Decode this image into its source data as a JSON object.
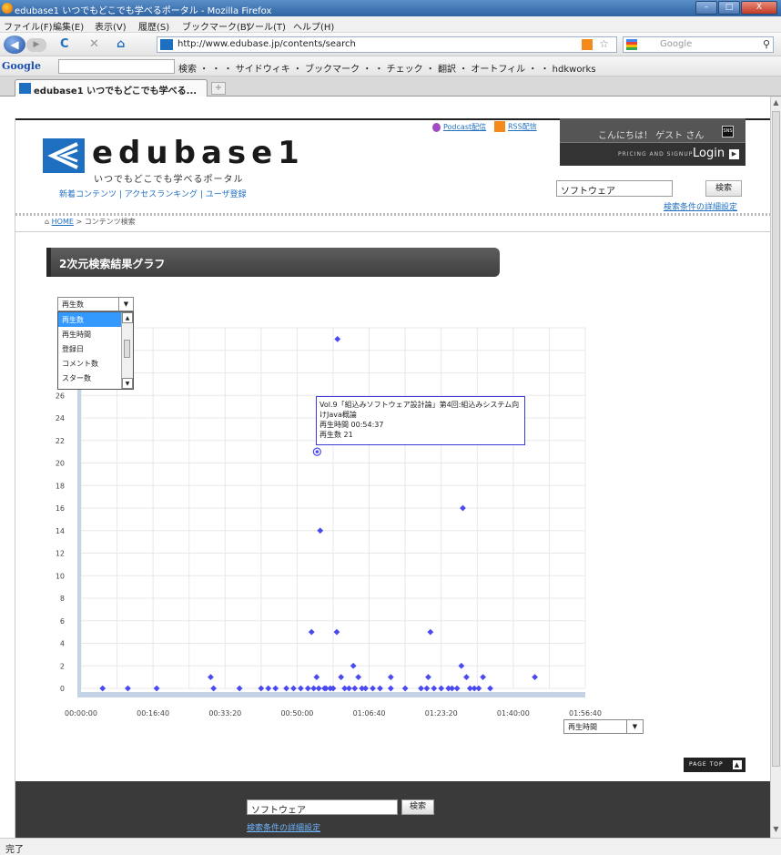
{
  "window": {
    "title": "edubase1 いつでもどこでも学べるポータル - Mozilla Firefox",
    "min": "–",
    "max": "□",
    "close": "X"
  },
  "menu": [
    "ファイル(F)",
    "編集(E)",
    "表示(V)",
    "履歴(S)",
    "ブックマーク(B)",
    "ツール(T)",
    "ヘルプ(H)"
  ],
  "nav": {
    "url": "http://www.edubase.jp/contents/search",
    "search_placeholder": "Google"
  },
  "google_toolbar": {
    "logo": "Google",
    "items": "検索 ・ ・ ・ サイドウィキ ・ ブックマーク ・ ・ チェック ・ 翻訳 ・ オートフィル ・   ・ hdkworks"
  },
  "tab": {
    "label": "edubase1 いつでもどこでも学べる...",
    "new_tab": "+"
  },
  "header": {
    "logo_name": "edubase1",
    "tagline": "いつでもどこでも学べるポータル",
    "links": "新着コンテンツ | アクセスランキング | ユーザ登録",
    "podcast": "Podcast配信",
    "rss": "RSS配信",
    "greeting": "こんにちは！ ゲスト さん",
    "sns": "SNS",
    "pricing": "PRICING AND SIGNUP",
    "login": "Login",
    "search_value": "ソフトウェア",
    "search_button": "検索",
    "advanced": "検索条件の詳細設定"
  },
  "breadcrumb": {
    "home": "HOME",
    "current": "> コンテンツ検索"
  },
  "section_title": "2次元検索結果グラフ",
  "y_select": {
    "value": "再生数",
    "options": [
      "再生数",
      "再生時間",
      "登録日",
      "コメント数",
      "スター数"
    ],
    "selected_index": 0
  },
  "x_select": {
    "value": "再生時間"
  },
  "tooltip": {
    "line1": "Vol.9「組込みソフトウェア設計論」第4回:組込みシステム向",
    "line2": "けJava概論",
    "line3": "再生時間 00:54:37",
    "line4": "再生数 21"
  },
  "chart_data": {
    "type": "scatter",
    "xlabel": "",
    "ylabel": "",
    "x_ticks": [
      "00:00:00",
      "00:16:40",
      "00:33:20",
      "00:50:00",
      "01:06:40",
      "01:23:20",
      "01:40:00",
      "01:56:40"
    ],
    "y_ticks": [
      0,
      2,
      4,
      6,
      8,
      10,
      12,
      14,
      16,
      18,
      20,
      22,
      24,
      26
    ],
    "xlim_seconds": [
      0,
      7000
    ],
    "ylim": [
      0,
      32
    ],
    "color": "#4a4af0",
    "points": [
      {
        "x": 300,
        "y": 0
      },
      {
        "x": 650,
        "y": 0
      },
      {
        "x": 1050,
        "y": 0
      },
      {
        "x": 1840,
        "y": 0
      },
      {
        "x": 1800,
        "y": 1
      },
      {
        "x": 2200,
        "y": 0
      },
      {
        "x": 2500,
        "y": 0
      },
      {
        "x": 2600,
        "y": 0
      },
      {
        "x": 2700,
        "y": 0
      },
      {
        "x": 2850,
        "y": 0
      },
      {
        "x": 2950,
        "y": 0
      },
      {
        "x": 3050,
        "y": 0
      },
      {
        "x": 3150,
        "y": 0
      },
      {
        "x": 3230,
        "y": 0
      },
      {
        "x": 3300,
        "y": 0
      },
      {
        "x": 3380,
        "y": 0
      },
      {
        "x": 3200,
        "y": 5
      },
      {
        "x": 3270,
        "y": 1
      },
      {
        "x": 3320,
        "y": 14
      },
      {
        "x": 3400,
        "y": 0
      },
      {
        "x": 3460,
        "y": 0
      },
      {
        "x": 3500,
        "y": 0
      },
      {
        "x": 3550,
        "y": 5
      },
      {
        "x": 3560,
        "y": 31
      },
      {
        "x": 3610,
        "y": 1
      },
      {
        "x": 3660,
        "y": 0
      },
      {
        "x": 3720,
        "y": 0
      },
      {
        "x": 3780,
        "y": 2
      },
      {
        "x": 3800,
        "y": 0
      },
      {
        "x": 3850,
        "y": 1
      },
      {
        "x": 3900,
        "y": 0
      },
      {
        "x": 3950,
        "y": 0
      },
      {
        "x": 4050,
        "y": 0
      },
      {
        "x": 4150,
        "y": 0
      },
      {
        "x": 4300,
        "y": 1
      },
      {
        "x": 4300,
        "y": 0
      },
      {
        "x": 4500,
        "y": 0
      },
      {
        "x": 4720,
        "y": 0
      },
      {
        "x": 4800,
        "y": 0
      },
      {
        "x": 4820,
        "y": 1
      },
      {
        "x": 4850,
        "y": 5
      },
      {
        "x": 4900,
        "y": 0
      },
      {
        "x": 5000,
        "y": 0
      },
      {
        "x": 5100,
        "y": 0
      },
      {
        "x": 5150,
        "y": 0
      },
      {
        "x": 5220,
        "y": 0
      },
      {
        "x": 5280,
        "y": 2
      },
      {
        "x": 5300,
        "y": 16
      },
      {
        "x": 5350,
        "y": 1
      },
      {
        "x": 5400,
        "y": 0
      },
      {
        "x": 5460,
        "y": 0
      },
      {
        "x": 5520,
        "y": 0
      },
      {
        "x": 5580,
        "y": 1
      },
      {
        "x": 5680,
        "y": 0
      },
      {
        "x": 6300,
        "y": 1
      }
    ],
    "highlight": {
      "x": 3277,
      "y": 21
    }
  },
  "page_top": "PAGE TOP",
  "footer": {
    "search_value": "ソフトウェア",
    "search_button": "検索",
    "advanced": "検索条件の詳細設定"
  },
  "status": "完了"
}
